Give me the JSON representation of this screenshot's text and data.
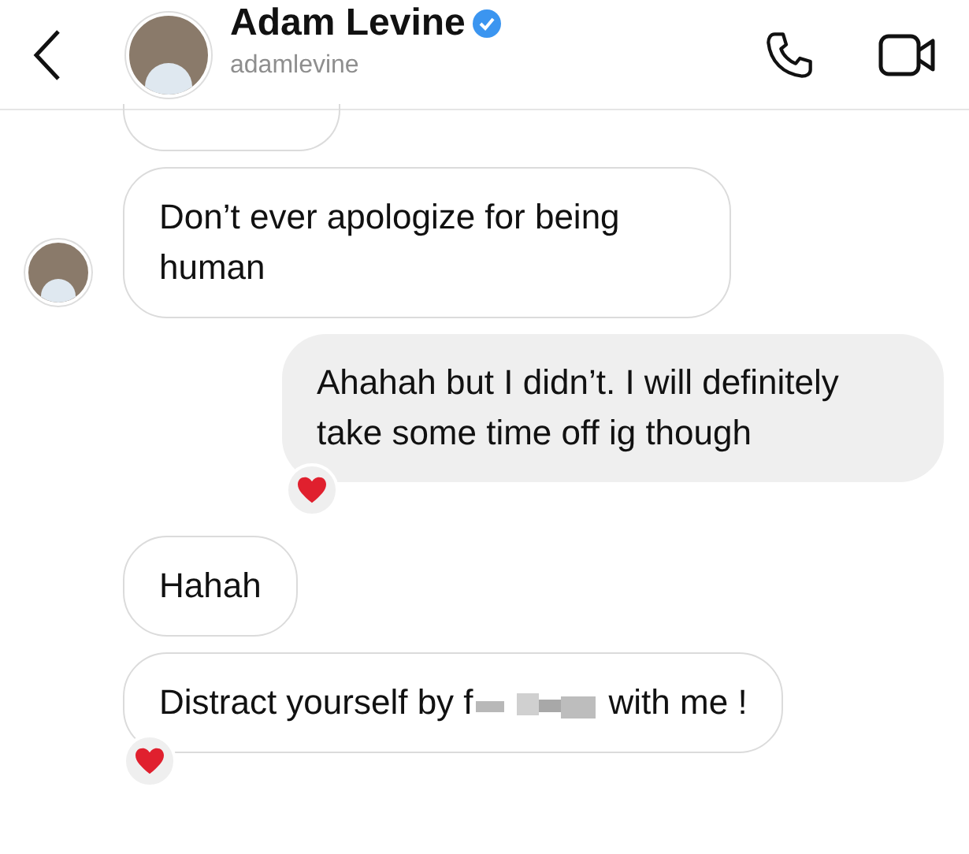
{
  "header": {
    "name": "Adam Levine",
    "verified": true,
    "username": "adamlevine"
  },
  "messages": [
    {
      "kind": "incoming",
      "text": "Don’t ever apologize for being human",
      "avatar": true,
      "reaction": false
    },
    {
      "kind": "outgoing",
      "text": "Ahahah but I didn’t. I will definitely take some time off ig though",
      "reaction": true
    },
    {
      "kind": "incoming",
      "text": "Hahah",
      "avatar": false,
      "reaction": false
    },
    {
      "kind": "incoming",
      "text": "Distract yourself by f",
      "text_after": "with me !",
      "redacted": true,
      "avatar": false,
      "reaction": true
    }
  ]
}
